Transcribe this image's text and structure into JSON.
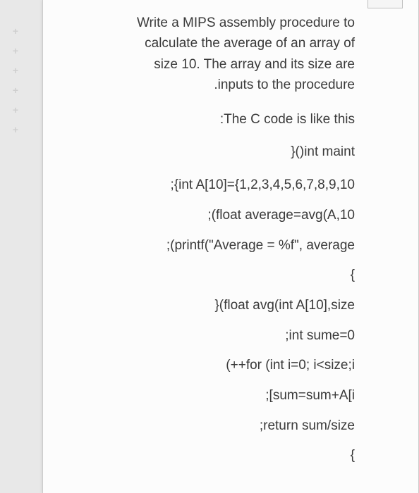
{
  "gutter": {
    "marks": [
      "+",
      "+",
      "+",
      "+",
      "+",
      "+"
    ]
  },
  "intro": {
    "l1": "Write a MIPS assembly procedure to",
    "l2": "calculate the average of an array of",
    "l3": "size 10. The array and its size are",
    "l4": ".inputs to the procedure"
  },
  "lines": [
    ":The C code is like this",
    "}()int maint",
    ";{int A[10]={1,2,3,4,5,6,7,8,9,10",
    ";(float average=avg(A,10",
    ";(printf(\"Average = %f\", average",
    "{",
    "}(float avg(int A[10],size",
    ";int sume=0",
    "(++for (int i=0; i<size;i",
    ";[sum=sum+A[i",
    ";return sum/size",
    "{"
  ]
}
